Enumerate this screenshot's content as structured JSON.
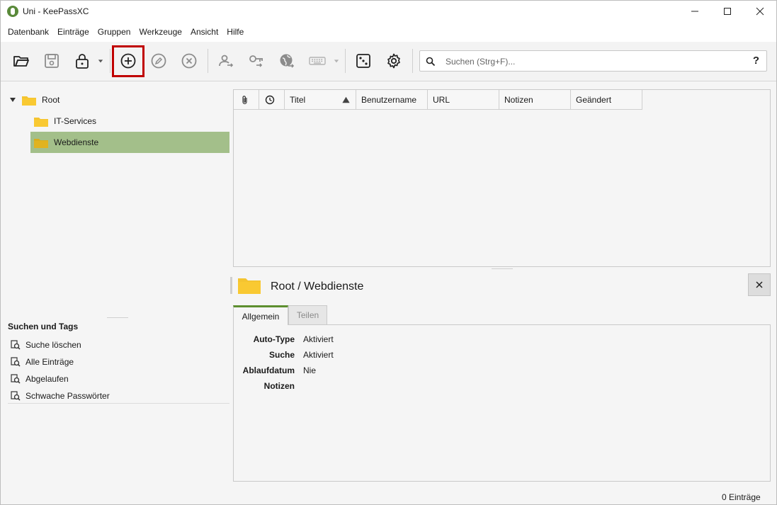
{
  "window": {
    "title": "Uni - KeePassXC",
    "controls": [
      "minimize",
      "maximize",
      "close"
    ]
  },
  "menu": [
    "Datenbank",
    "Einträge",
    "Gruppen",
    "Werkzeuge",
    "Ansicht",
    "Hilfe"
  ],
  "toolbar": {
    "icons": [
      "folder-open-icon",
      "save-icon",
      "lock-icon",
      "add-entry-icon",
      "edit-entry-icon",
      "delete-entry-icon",
      "copy-username-icon",
      "copy-password-icon",
      "open-url-icon",
      "autotype-keyboard-icon",
      "password-generator-icon",
      "settings-icon"
    ]
  },
  "search": {
    "placeholder": "Suchen (Strg+F)...",
    "help": "?"
  },
  "groups": {
    "root": "Root",
    "children": [
      "IT-Services",
      "Webdienste"
    ],
    "selected": "Webdienste"
  },
  "tags": {
    "title": "Suchen und Tags",
    "items": [
      "Suche löschen",
      "Alle Einträge",
      "Abgelaufen",
      "Schwache Passwörter"
    ]
  },
  "table": {
    "columns": [
      "Titel",
      "Benutzername",
      "URL",
      "Notizen",
      "Geändert"
    ]
  },
  "preview": {
    "title": "Root / Webdienste",
    "tabs": [
      "Allgemein",
      "Teilen"
    ],
    "fields": [
      {
        "label": "Auto-Type",
        "value": "Aktiviert"
      },
      {
        "label": "Suche",
        "value": "Aktiviert"
      },
      {
        "label": "Ablaufdatum",
        "value": "Nie"
      },
      {
        "label": "Notizen",
        "value": ""
      }
    ]
  },
  "status": {
    "entries": "0 Einträge"
  },
  "colors": {
    "selection": "#a3bf8a",
    "accent": "#5d8f2f",
    "folder": "#f4c430",
    "highlight": "#c00000"
  }
}
